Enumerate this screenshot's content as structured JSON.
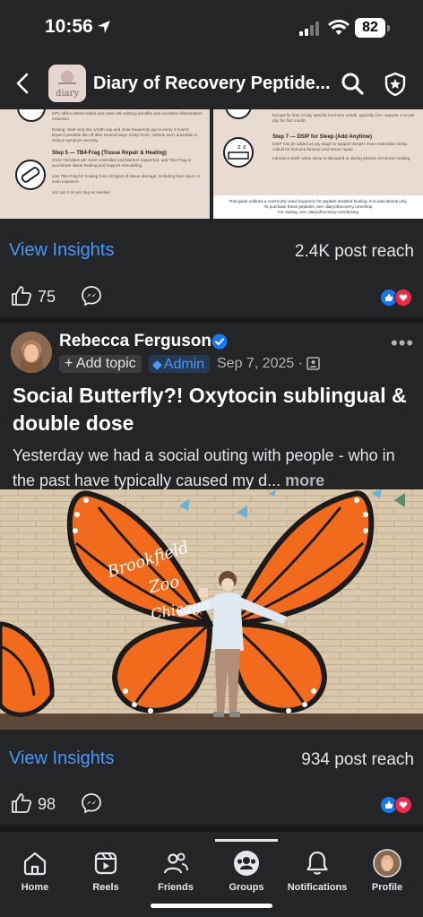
{
  "status_bar": {
    "time": "10:56",
    "battery": "82"
  },
  "header": {
    "group_title": "Diary of Recovery Peptide...",
    "group_image_text": "diary"
  },
  "first_post": {
    "image_left": {
      "step_title": "Step 5 — TB4-Frag (Tissue Repair & Healing)",
      "lines": [
        "KPV offers antimicrobial and mast cell-calming benefits and excellent inflammation reduction.",
        "Dosing: Start very low 1/10th cap and dose frequently (up to every 3 hours)",
        "Expect possible die-off after several days. Keep NAD+ Selank and Larazotide to reduce symptom severity.",
        "Once microbes are more controlled and barriers supported, add TB4-Frag to accelerate tissue healing and support remodeling.",
        "Use TB4-Frag for healing from all types of tissue damage, including from injury or toxin exposure.",
        "1/4 cap 2-3x per day as needed"
      ]
    },
    "image_right": {
      "step_title": "Step 7 — DSIP for Sleep (Add Anytime)",
      "lines": [
        "Except for time of day specific hormone needs, typically 1/4+ capsule 1-3x per day for first month.",
        "DSIP can be added at any stage to support deeper more restorative sleep, critical for immune function and tissue repair.",
        "Introduce DSIP when sleep is disrupted or during phases of intense healing.",
        "This guide outlines a commonly used sequence for peptide-assisted healing. It is educational only.",
        "To purchase these peptides, see: diaryofrecovery.com/shop",
        "For dosing, see: diaryofrecovery.com/dosing"
      ]
    },
    "view_insights": "View Insights",
    "post_reach": "2.4K post reach",
    "like_count": "75"
  },
  "second_post": {
    "author": "Rebecca Ferguson",
    "add_topic": "+ Add topic",
    "admin_badge": "Admin",
    "date": "Sep 7, 2025 ·",
    "title": "Social Butterfly?! Oxytocin sublingual & double dose",
    "body": "Yesterday we had a social outing with people - who in the past have typically caused my d...",
    "more_link": "more",
    "mural_text": [
      "Brookfield",
      "Zoo",
      "Chicago"
    ],
    "view_insights": "View Insights",
    "post_reach": "934 post reach",
    "like_count": "98"
  },
  "nav": {
    "items": [
      {
        "label": "Home",
        "icon": "home-icon"
      },
      {
        "label": "Reels",
        "icon": "reels-icon"
      },
      {
        "label": "Friends",
        "icon": "friends-icon"
      },
      {
        "label": "Groups",
        "icon": "groups-icon"
      },
      {
        "label": "Notifications",
        "icon": "bell-icon"
      },
      {
        "label": "Profile",
        "icon": "profile-avatar"
      }
    ],
    "active": "Groups"
  },
  "colors": {
    "background": "#242526",
    "accent": "#4599ff",
    "like": "#1877f2",
    "love": "#f02849",
    "butterfly": "#f26b1d"
  }
}
